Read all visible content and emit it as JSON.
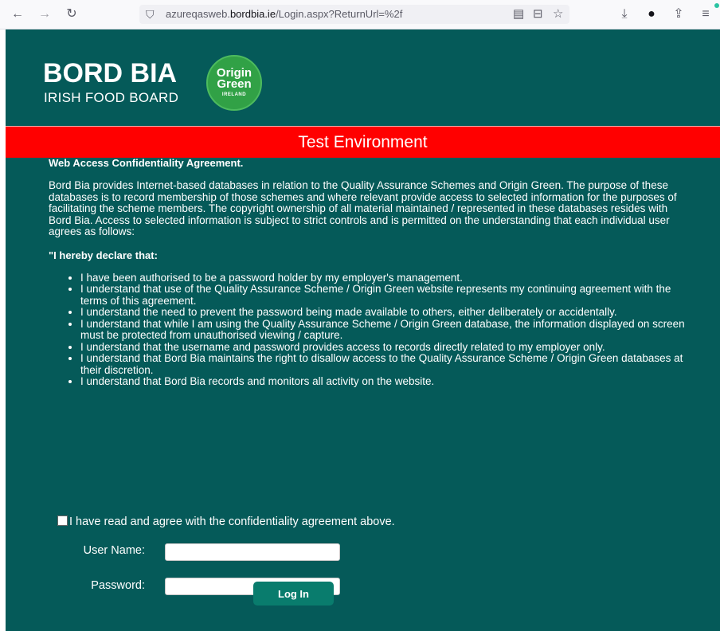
{
  "browser": {
    "url_prefix": "azureqasweb.",
    "url_domain": "bordbia.ie",
    "url_path": "/Login.aspx?ReturnUrl=%2f",
    "icons": {
      "back": "←",
      "forward": "→",
      "reload": "↻",
      "shield": "⛉",
      "reader": "▤",
      "pocket": "⊟",
      "bookmark": "☆",
      "download": "⤓",
      "account": "●",
      "share": "⇪",
      "menu": "≡"
    }
  },
  "header": {
    "logo_title": "BORD BIA",
    "logo_subtitle": "IRISH FOOD BOARD",
    "badge_line1": "Origin",
    "badge_line2": "Green",
    "badge_line3": "IRELAND"
  },
  "banner": {
    "text": "Test Environment"
  },
  "agreement": {
    "title": "Web Access Confidentiality Agreement.",
    "intro": "Bord Bia provides Internet-based databases in relation to the Quality Assurance Schemes and Origin Green. The purpose of these databases is to record membership of those schemes and where relevant provide access to selected information for the purposes of facilitating the scheme members. The copyright ownership of all material maintained / represented in these databases resides with Bord Bia. Access to selected information is subject to strict controls and is permitted on the understanding that each individual user agrees as follows:",
    "declare_title": "\"I hereby declare that:",
    "items": [
      "I have been authorised to be a password holder by my employer's management.",
      "I understand that use of the Quality Assurance Scheme / Origin Green website represents my continuing agreement with the terms of this agreement.",
      "I understand the need to prevent the password being made available to others, either deliberately or accidentally.",
      "I understand that while I am using the Quality Assurance Scheme / Origin Green database, the information displayed on screen must be protected from unauthorised viewing / capture.",
      "I understand that the username and password provides access to records directly related to my employer only.",
      "I understand that Bord Bia maintains the right to disallow access to the Quality Assurance Scheme / Origin Green databases at their discretion.",
      "I understand that Bord Bia records and monitors all activity on the website."
    ]
  },
  "form": {
    "agree_label": "I have read and agree with the confidentiality agreement above.",
    "username_label": "User Name:",
    "username_value": "",
    "password_label": "Password:",
    "password_value": "",
    "login_label": "Log In"
  },
  "colors": {
    "page_bg": "#055a59",
    "banner": "#ff0000",
    "button": "#097c6d",
    "badge": "#31a146"
  }
}
